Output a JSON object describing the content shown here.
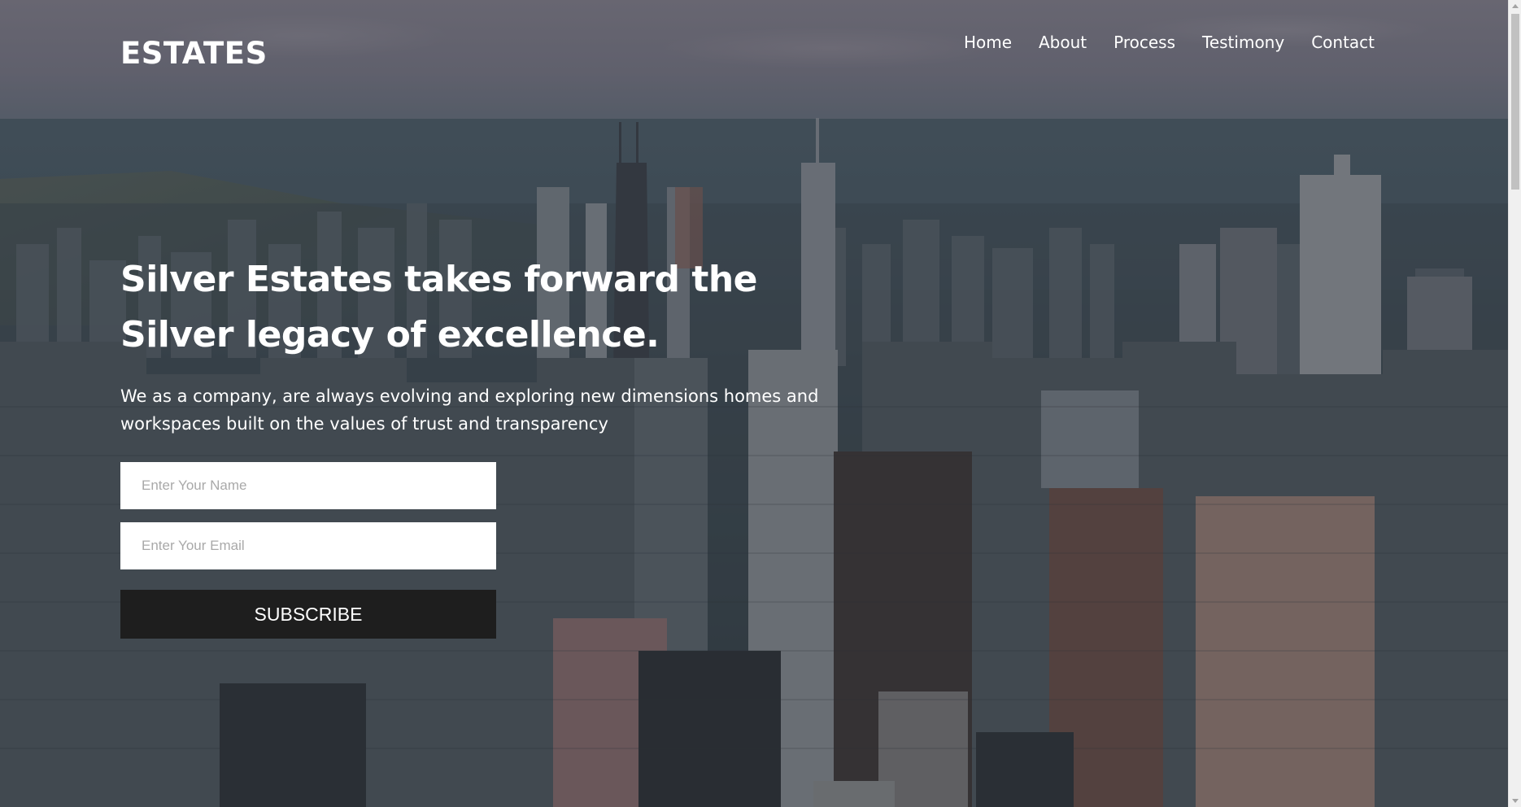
{
  "header": {
    "logo": "ESTATES",
    "nav": [
      "Home",
      "About",
      "Process",
      "Testimony",
      "Contact"
    ]
  },
  "hero": {
    "title": "Silver Estates takes forward the Silver legacy of excellence.",
    "subtitle": "We as a company, are always evolving and exploring new dimensions homes and workspaces built on the values of trust and transparency"
  },
  "form": {
    "name_placeholder": "Enter Your Name",
    "email_placeholder": "Enter Your Email",
    "name_value": "",
    "email_value": "",
    "submit_label": "SUBSCRIBE"
  },
  "colors": {
    "button_bg": "#1e1e1e",
    "text": "#ffffff"
  }
}
